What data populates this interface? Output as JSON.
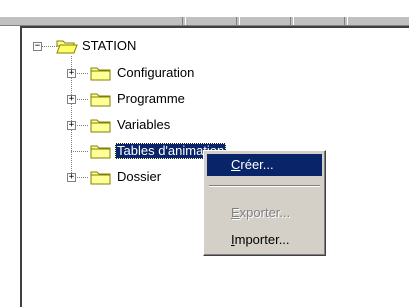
{
  "tree": {
    "root": {
      "label": "STATION",
      "expander": "−",
      "icon": "open-folder-icon"
    },
    "children": [
      {
        "label": "Configuration",
        "expander": "+",
        "icon": "folder-icon"
      },
      {
        "label": "Programme",
        "expander": "+",
        "icon": "folder-icon"
      },
      {
        "label": "Variables",
        "expander": "+",
        "icon": "folder-icon"
      },
      {
        "label": "Tables d'animation",
        "expander": "",
        "icon": "folder-icon",
        "selected": true
      },
      {
        "label": "Dossier",
        "expander": "+",
        "icon": "folder-icon"
      }
    ]
  },
  "context_menu": {
    "items": [
      {
        "label_first": "C",
        "label_rest": "réer...",
        "state": "highlighted"
      },
      {
        "label_first": "E",
        "label_rest": "xporter...",
        "state": "disabled"
      },
      {
        "label_first": "I",
        "label_rest": "mporter...",
        "state": "enabled"
      }
    ]
  },
  "colors": {
    "selection": "#0a246a",
    "menu_bg": "#d4d0c8",
    "folder_yellow": "#ffff99",
    "folder_outline": "#808000"
  }
}
